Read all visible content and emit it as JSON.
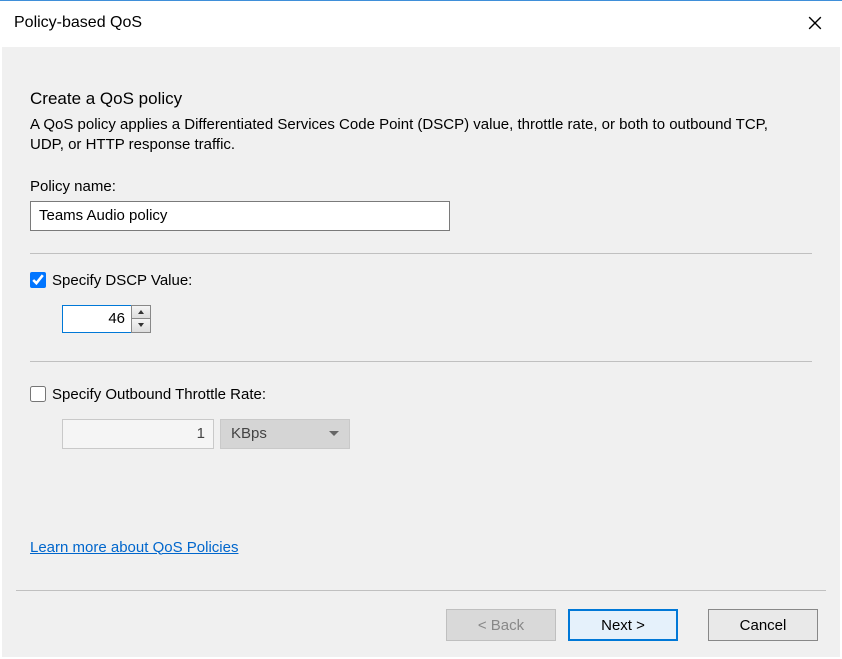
{
  "window": {
    "title": "Policy-based QoS"
  },
  "page": {
    "heading": "Create a QoS policy",
    "description": "A QoS policy applies a Differentiated Services Code Point (DSCP) value, throttle rate, or both to outbound TCP, UDP, or HTTP response traffic."
  },
  "policy_name": {
    "label": "Policy name:",
    "value": "Teams Audio policy"
  },
  "dscp": {
    "checkbox_label": "Specify DSCP Value:",
    "checked": true,
    "value": "46"
  },
  "throttle": {
    "checkbox_label": "Specify Outbound Throttle Rate:",
    "checked": false,
    "value": "1",
    "unit": "KBps"
  },
  "link": {
    "label": "Learn more about QoS Policies"
  },
  "footer": {
    "back": "< Back",
    "next": "Next >",
    "cancel": "Cancel"
  }
}
